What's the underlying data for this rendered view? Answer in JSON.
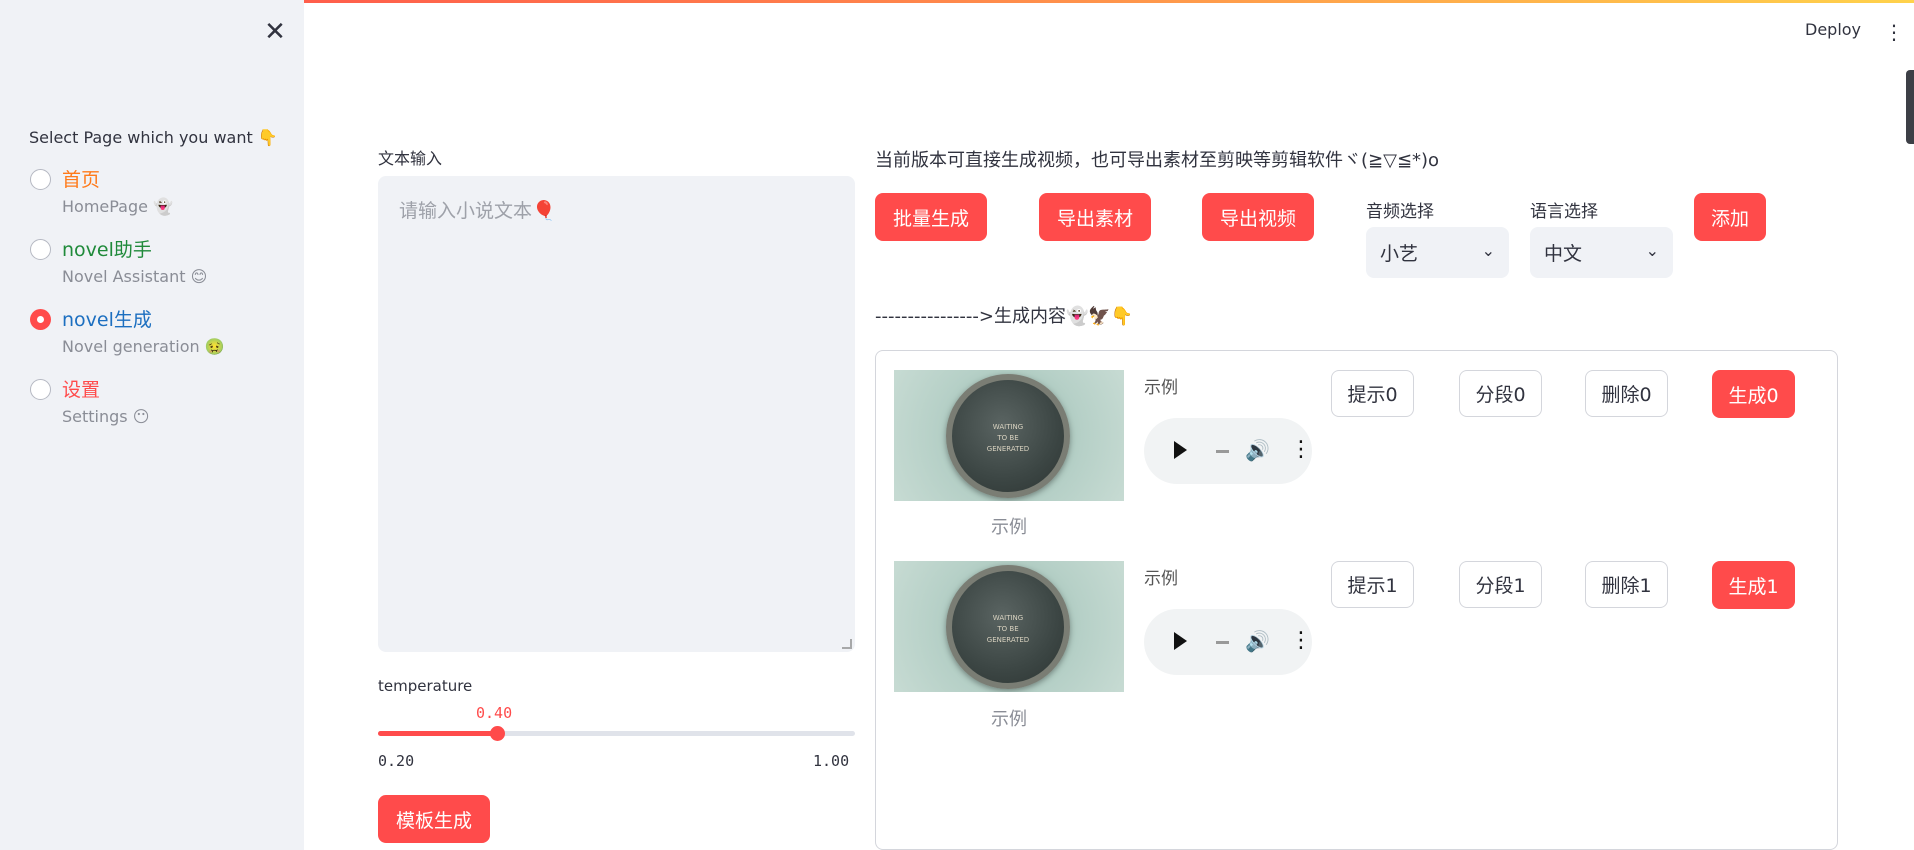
{
  "app": {
    "deploy_label": "Deploy"
  },
  "sidebar": {
    "title": "Select Page which you want 👇",
    "items": [
      {
        "label": "首页",
        "sub": "HomePage 👻",
        "color": "#ff7a1a",
        "checked": false
      },
      {
        "label": "novel助手",
        "sub": "Novel Assistant 😊",
        "color": "#1f8a3a",
        "checked": false
      },
      {
        "label": "novel生成",
        "sub": "Novel generation 🤢",
        "color": "#1c6fc0",
        "checked": true
      },
      {
        "label": "设置",
        "sub": "Settings 😶",
        "color": "#ff4b4b",
        "checked": false
      }
    ]
  },
  "left": {
    "text_label": "文本输入",
    "text_placeholder": "请输入小说文本🎈",
    "temperature_label": "temperature",
    "temperature_value": "0.40",
    "temperature_min": "0.20",
    "temperature_max": "1.00",
    "temperature_fraction": 0.25,
    "template_button": "模板生成"
  },
  "right": {
    "info_text": "当前版本可直接生成视频，也可导出素材至剪映等剪辑软件ヾ(≧▽≦*)o",
    "batch_button": "批量生成",
    "export_assets_button": "导出素材",
    "export_video_button": "导出视频",
    "audio_select_label": "音频选择",
    "audio_select_value": "小艺",
    "language_select_label": "语言选择",
    "language_select_value": "中文",
    "add_button": "添加",
    "section_header": "---------------->生成内容👻🦅👇"
  },
  "rows": [
    {
      "image_text": "WAITING\nTO BE\nGENERATED",
      "caption": "示例",
      "text": "示例",
      "hint": "提示0",
      "segment": "分段0",
      "delete": "删除0",
      "generate": "生成0"
    },
    {
      "image_text": "WAITING\nTO BE\nGENERATED",
      "caption": "示例",
      "text": "示例",
      "hint": "提示1",
      "segment": "分段1",
      "delete": "删除1",
      "generate": "生成1"
    }
  ],
  "colors": {
    "accent": "#ff4b4b",
    "sidebar_bg": "#f0f2f6"
  }
}
